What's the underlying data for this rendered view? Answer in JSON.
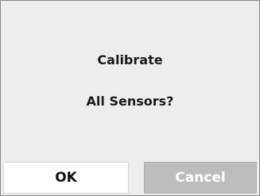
{
  "dialog": {
    "message_line1": "Calibrate",
    "message_line2": "All Sensors?",
    "buttons": {
      "ok_label": "OK",
      "cancel_label": "Cancel"
    }
  },
  "colors": {
    "dialog_background": "#ededed",
    "ok_button_background": "#ffffff",
    "cancel_button_background": "#bdbdbd",
    "cancel_button_text": "#ffffff",
    "text": "#1a1a1a"
  }
}
